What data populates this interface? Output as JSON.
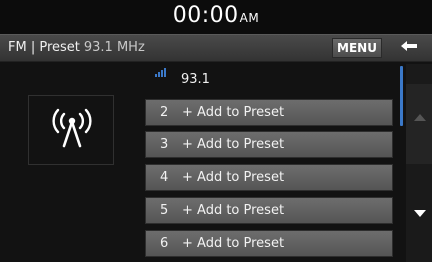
{
  "status_bar": {
    "time": "00:00",
    "ampm": "AM"
  },
  "header": {
    "band": "FM | Preset",
    "frequency": "93.1 MHz",
    "menu_label": "MENU",
    "back_icon": "back-arrow-icon"
  },
  "station_art": {
    "icon": "antenna-icon"
  },
  "current": {
    "frequency": "93.1",
    "signal_icon": "signal-strength-icon"
  },
  "presets": [
    {
      "number": "2",
      "label": "+ Add to Preset"
    },
    {
      "number": "3",
      "label": "+ Add to Preset"
    },
    {
      "number": "4",
      "label": "+ Add to Preset"
    },
    {
      "number": "5",
      "label": "+ Add to Preset"
    },
    {
      "number": "6",
      "label": "+ Add to Preset"
    }
  ],
  "scroll": {
    "up_icon": "scroll-up-icon",
    "down_icon": "scroll-down-icon"
  },
  "colors": {
    "accent": "#3b79c9",
    "button": "#606060",
    "background": "#121212"
  }
}
